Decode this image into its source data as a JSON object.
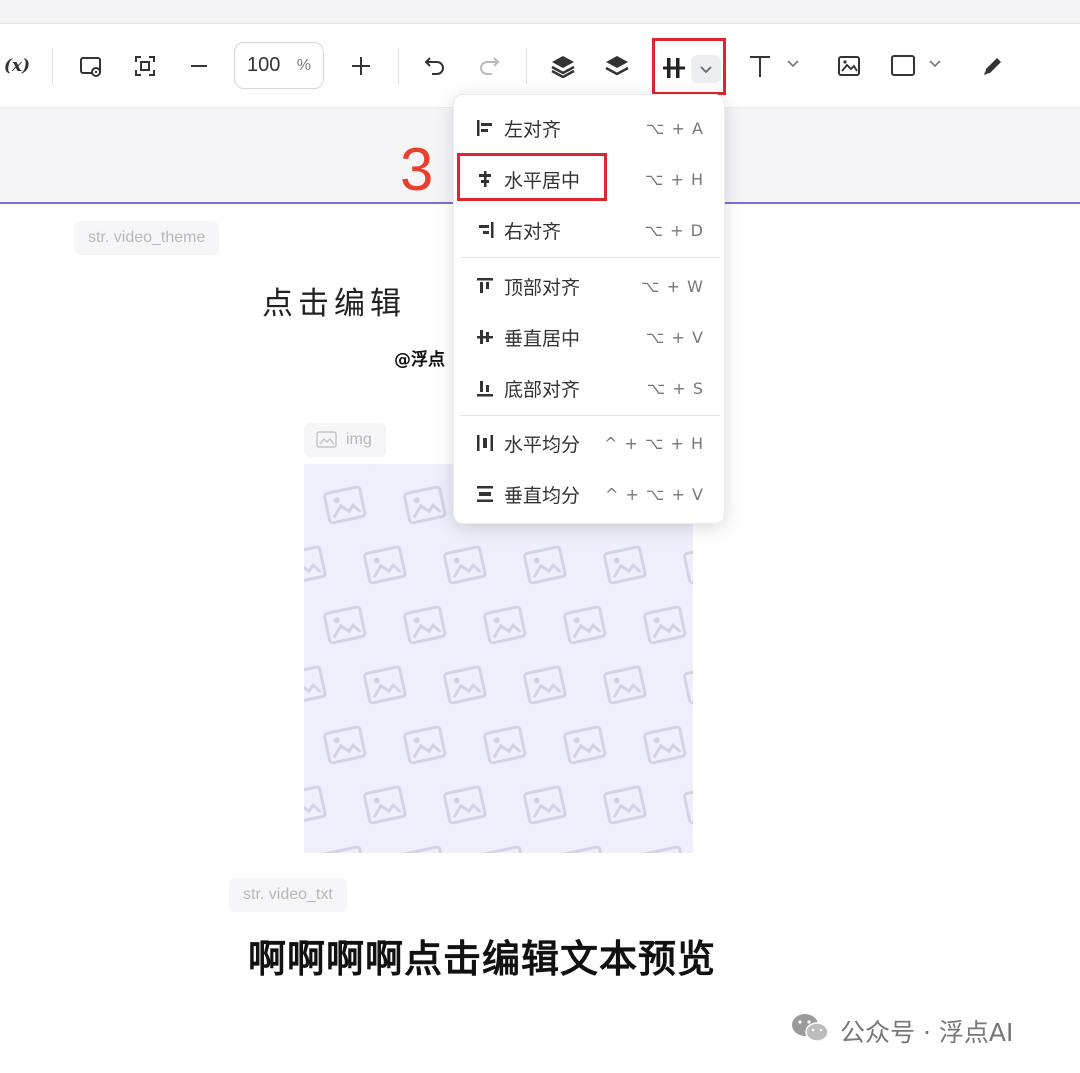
{
  "toolbar": {
    "variable_label": "(x)",
    "zoom_value": "100",
    "zoom_unit": "%"
  },
  "align_menu": {
    "items": [
      {
        "label": "左对齐",
        "shortcut": "⌥ + A"
      },
      {
        "label": "水平居中",
        "shortcut": "⌥ + H"
      },
      {
        "label": "右对齐",
        "shortcut": "⌥ + D"
      },
      {
        "label": "顶部对齐",
        "shortcut": "⌥ + W"
      },
      {
        "label": "垂直居中",
        "shortcut": "⌥ + V"
      },
      {
        "label": "底部对齐",
        "shortcut": "⌥ + S"
      },
      {
        "label": "水平均分",
        "shortcut": "^ + ⌥ + H"
      },
      {
        "label": "垂直均分",
        "shortcut": "^ + ⌥ + V"
      }
    ]
  },
  "annotation": {
    "step_number": "3"
  },
  "canvas": {
    "theme_tag": "str. video_theme",
    "heading_text": "点击编辑",
    "author_text": "@浮点",
    "img_tag": "img",
    "txt_tag": "str. video_txt",
    "body_text": "啊啊啊啊点击编辑文本预览"
  },
  "watermark": {
    "text": "公众号 · 浮点AI"
  },
  "colors": {
    "highlight": "#e0242f",
    "step": "#e8402e",
    "accent_line": "#7b6fd6"
  }
}
